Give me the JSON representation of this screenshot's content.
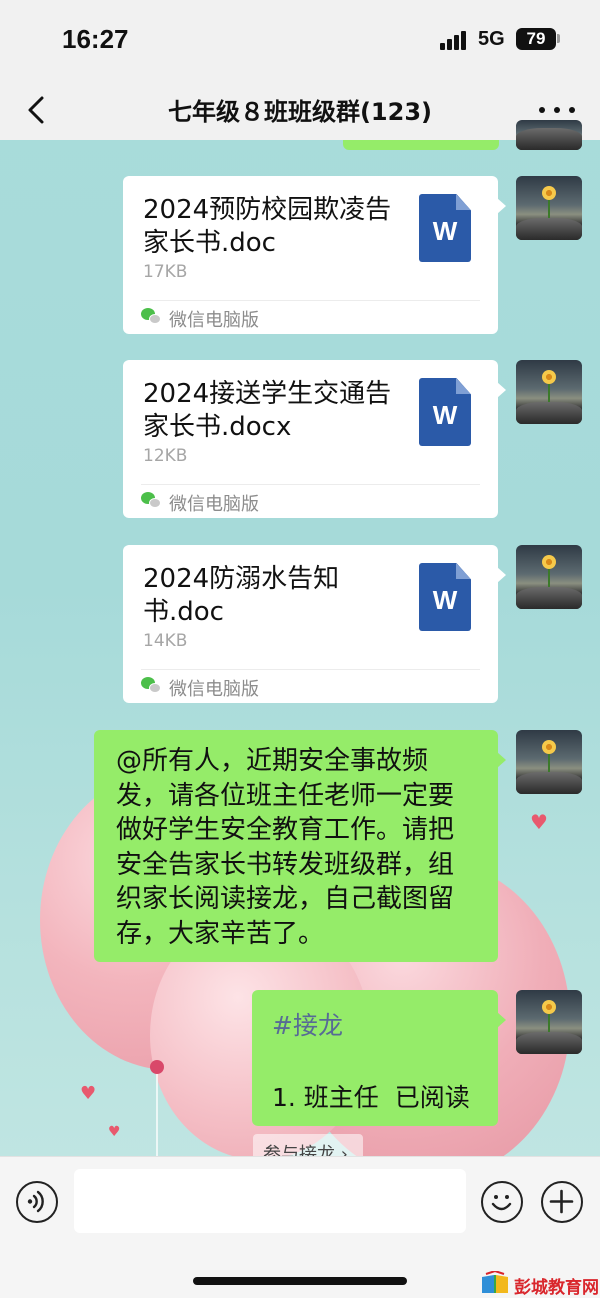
{
  "status_bar": {
    "time": "16:27",
    "network": "5G",
    "battery": "79"
  },
  "header": {
    "title": "七年级８班班级群(123)"
  },
  "messages": {
    "files": [
      {
        "name": "2024预防校园欺凌告家长书.doc",
        "size": "17KB",
        "source": "微信电脑版",
        "icon_letter": "W"
      },
      {
        "name": "2024接送学生交通告家长书.docx",
        "size": "12KB",
        "source": "微信电脑版",
        "icon_letter": "W"
      },
      {
        "name": "2024防溺水告知书.doc",
        "size": "14KB",
        "source": "微信电脑版",
        "icon_letter": "W"
      }
    ],
    "notice": "@所有人，近期安全事故频发，请各位班主任老师一定要做好学生安全教育工作。请把安全告家长书转发班级群，组织家长阅读接龙，自己截图留存，大家辛苦了。",
    "jielong": {
      "tag": "#接龙",
      "entry": "1. 班主任  已阅读",
      "join_label": "参与接龙 ›"
    }
  },
  "input_bar": {
    "placeholder": ""
  },
  "watermark": {
    "text": "彭城教育网"
  },
  "colors": {
    "bubble_green": "#95ec69",
    "word_blue": "#2b5aa8",
    "link_blue": "#576b95"
  }
}
